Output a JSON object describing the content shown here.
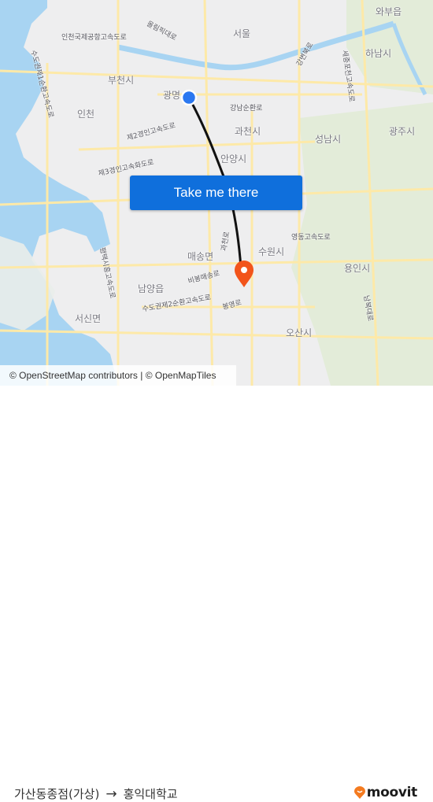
{
  "map": {
    "labels": {
      "seoul": "서울",
      "waebu": "와부읍",
      "hanam": "하남시",
      "bucheon": "부천시",
      "gwangmyeong": "광명",
      "incheon": "인천",
      "gwacheon": "과천시",
      "seongnam": "성남시",
      "gwangju": "광주시",
      "anyang": "안양시",
      "suwon": "수원시",
      "yongin": "용인시",
      "maesong": "매송면",
      "namyang": "남양읍",
      "seosin": "서신면",
      "osan": "오산시",
      "road_airport": "인천국제공항고속도로",
      "road_olympic": "올림픽대로",
      "road_gangbyeon": "강변북로",
      "road_ring": "수도권제1순환고속도로",
      "road_southring": "강남순환로",
      "road_2nd_gyeongin": "제2경인고속도로",
      "road_3rd_gyeongin": "제3경인고속화도로",
      "road_sejong": "세종포천고속도로",
      "road_yeongdong": "영동고속도로",
      "road_gwacheon": "과천로",
      "road_bibong": "비봉매송로",
      "road_ring2": "수도권제2순환고속도로",
      "road_bongyeong": "봉영로",
      "road_pyeongtaek": "평택시흥고속도로",
      "road_nambuk": "남북대로"
    },
    "origin_marker_color": "#2b78f0",
    "destination_marker_color": "#f2541b",
    "route_color": "#111111"
  },
  "cta": {
    "label": "Take me there",
    "color": "#0f6fdc"
  },
  "attribution": "© OpenStreetMap contributors | © OpenMapTiles",
  "footer": {
    "origin": "가산동종점(가상)",
    "arrow": "→",
    "destination": "홍익대학교",
    "brand": "moovit",
    "brand_color": "#f47b20"
  }
}
